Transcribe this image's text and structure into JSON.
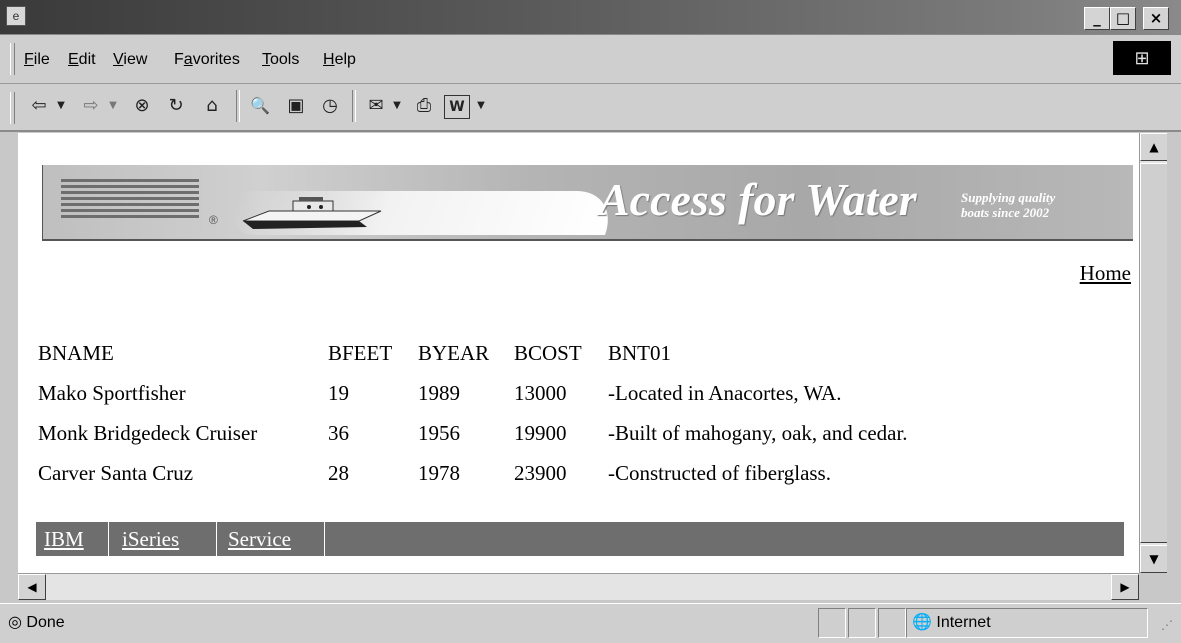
{
  "window": {
    "title": "",
    "controls": {
      "minimize": "_",
      "maximize": "□",
      "close": "×"
    }
  },
  "menu": {
    "items": [
      {
        "label": "File",
        "accel": "F"
      },
      {
        "label": "Edit",
        "accel": "E"
      },
      {
        "label": "View",
        "accel": "V"
      },
      {
        "label": "Favorites",
        "accel": "a"
      },
      {
        "label": "Tools",
        "accel": "T"
      },
      {
        "label": "Help",
        "accel": "H"
      }
    ]
  },
  "toolbar": {
    "back": "⇦",
    "forward": "⇨",
    "stop": "⊗",
    "refresh": "↻",
    "home": "⌂",
    "search": "🔍",
    "favorites": "▣",
    "history": "◷",
    "mail": "✉",
    "print": "⎙",
    "edit": "W"
  },
  "banner": {
    "logo": "IBM",
    "title": "Access for Water",
    "tagline_line1": "Supplying quality",
    "tagline_line2": "boats since 2002"
  },
  "nav": {
    "home": "Home"
  },
  "table": {
    "headers": [
      "BNAME",
      "BFEET",
      "BYEAR",
      "BCOST",
      "BNT01"
    ],
    "rows": [
      [
        "Mako Sportfisher",
        "19",
        "1989",
        "13000",
        "-Located in Anacortes, WA."
      ],
      [
        "Monk Bridgedeck Cruiser",
        "36",
        "1956",
        "19900",
        "-Built of mahogany, oak, and cedar."
      ],
      [
        "Carver Santa Cruz",
        "28",
        "1978",
        "23900",
        "-Constructed of fiberglass."
      ]
    ]
  },
  "footer": {
    "links": [
      "IBM",
      "iSeries",
      "Service"
    ]
  },
  "status": {
    "text": "Done",
    "zone": "Internet"
  }
}
